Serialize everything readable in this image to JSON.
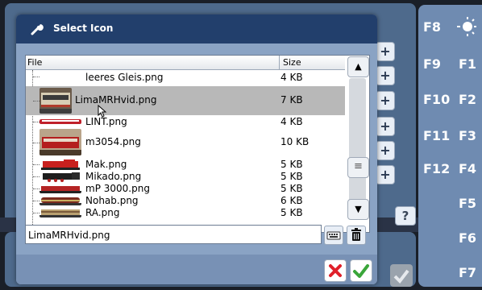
{
  "dialog": {
    "title": "Select Icon",
    "icon": "wrench-icon"
  },
  "file_list": {
    "columns": [
      "File",
      "Size"
    ],
    "rows": [
      {
        "name": "leeres Gleis.png",
        "size": "4 KB",
        "selected": false
      },
      {
        "name": "LimaMRHvid.png",
        "size": "7 KB",
        "selected": true
      },
      {
        "name": "LINT.png",
        "size": "4 KB",
        "selected": false
      },
      {
        "name": "m3054.png",
        "size": "10 KB",
        "selected": false
      },
      {
        "name": "Mak.png",
        "size": "5 KB",
        "selected": false
      },
      {
        "name": "Mikado.png",
        "size": "5 KB",
        "selected": false
      },
      {
        "name": "mP 3000.png",
        "size": "5 KB",
        "selected": false
      },
      {
        "name": "Nohab.png",
        "size": "6 KB",
        "selected": false
      },
      {
        "name": "RA.png",
        "size": "5 KB",
        "selected": false
      }
    ]
  },
  "filename_input": {
    "value": "LimaMRHvid.png"
  },
  "buttons": {
    "keyboard": "keyboard-icon",
    "delete": "trash-icon",
    "cancel": "close-icon",
    "ok": "check-icon",
    "scroll_up": "▲",
    "scroll_down": "▼",
    "scroll_thumb": "≡"
  },
  "function_keys": {
    "left": [
      "F8",
      "F9",
      "F10",
      "F11",
      "F12"
    ],
    "right": [
      "F1",
      "F2",
      "F3",
      "F4",
      "F5",
      "F6",
      "F7"
    ]
  },
  "background": {
    "plus_label": "+",
    "help_label": "?"
  },
  "colors": {
    "title_bar": "#223f6c",
    "dialog_body": "#8aa3c4",
    "selection": "#b8b8b8",
    "cancel_red": "#e0202a",
    "ok_green": "#3aa63a"
  }
}
